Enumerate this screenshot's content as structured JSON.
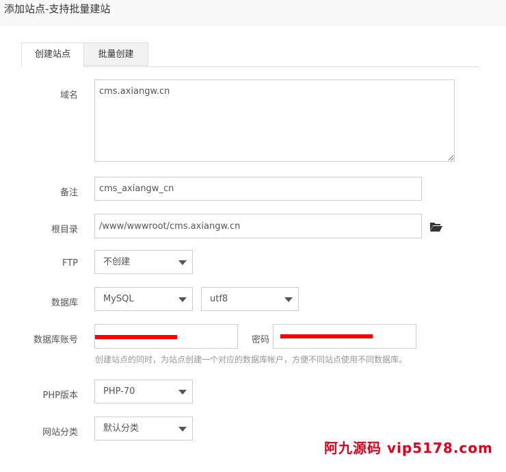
{
  "window": {
    "title": "添加站点-支持批量建站"
  },
  "tabs": [
    {
      "label": "创建站点",
      "active": true
    },
    {
      "label": "批量创建",
      "active": false
    }
  ],
  "form": {
    "domain": {
      "label": "域名",
      "value": "cms.axiangw.cn"
    },
    "remark": {
      "label": "备注",
      "value": "cms_axiangw_cn"
    },
    "root": {
      "label": "根目录",
      "value": "/www/wwwroot/cms.axiangw.cn",
      "icon": "folder-open-icon"
    },
    "ftp": {
      "label": "FTP",
      "selected": "不创建"
    },
    "database": {
      "label": "数据库",
      "type_selected": "MySQL",
      "charset_selected": "utf8"
    },
    "db_account": {
      "label": "数据库账号",
      "password_label": "密码",
      "hint": "创建站点的同时，为站点创建一个对应的数据库帐户，方便不同站点使用不同数据库。"
    },
    "php": {
      "label": "PHP版本",
      "selected": "PHP-70"
    },
    "category": {
      "label": "网站分类",
      "selected": "默认分类"
    }
  },
  "watermark": "阿九源码 vip5178.com",
  "colors": {
    "redaction": "#ff0000",
    "watermark": "#e0001b",
    "border": "#cccccc"
  }
}
